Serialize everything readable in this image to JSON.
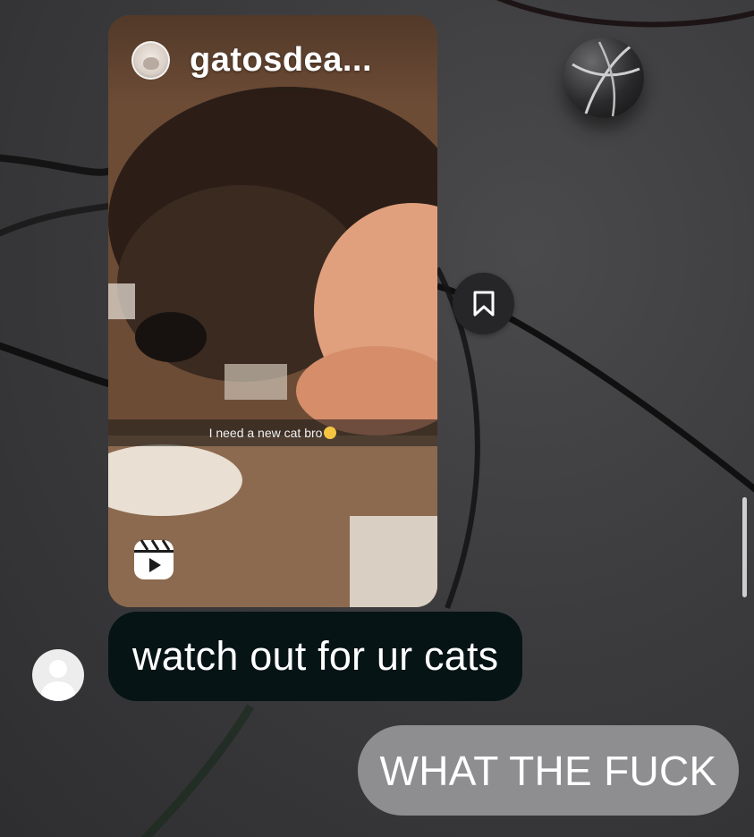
{
  "reel": {
    "username": "gatosdea...",
    "caption": "I need a new cat bro",
    "caption_emoji": "crying-face-emoji",
    "type_icon": "reels-icon"
  },
  "actions": {
    "save_icon": "bookmark-icon"
  },
  "messages": {
    "incoming": "watch out for ur cats",
    "outgoing": "WHAT THE FUCK"
  },
  "colors": {
    "incoming_bubble": "#061416",
    "outgoing_bubble": "#8e8e90",
    "background": "#3a3a3c"
  }
}
